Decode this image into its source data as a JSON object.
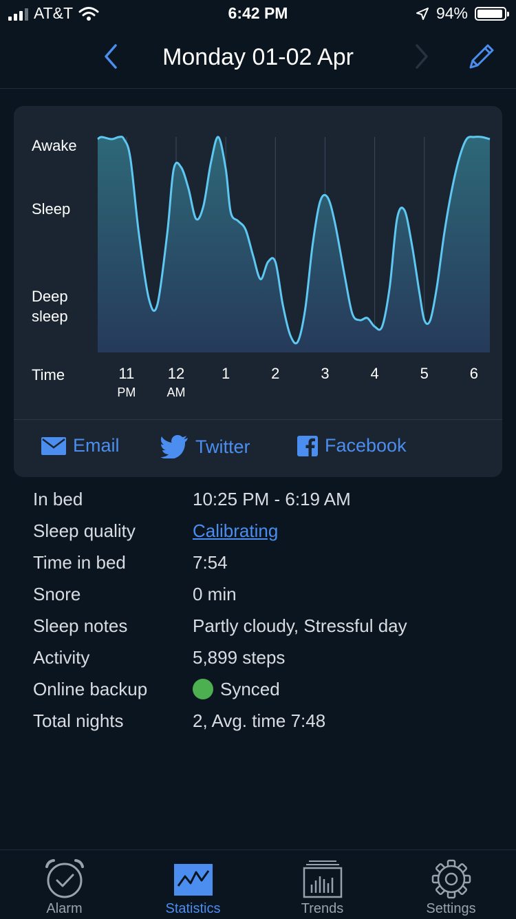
{
  "status_bar": {
    "carrier": "AT&T",
    "time": "6:42 PM",
    "battery": "94%",
    "battery_level": 0.94
  },
  "header": {
    "title": "Monday 01-02 Apr",
    "back_icon": "chevron-left-icon",
    "forward_icon": "chevron-right-icon",
    "edit_icon": "pencil-icon"
  },
  "chart_data": {
    "type": "area",
    "title": "",
    "y_levels": [
      "Awake",
      "Sleep",
      "Deep sleep"
    ],
    "y_range": [
      0,
      1
    ],
    "x_label": "Time",
    "x_ticks": [
      {
        "label": "11",
        "sub": "PM"
      },
      {
        "label": "12",
        "sub": "AM"
      },
      {
        "label": "1",
        "sub": ""
      },
      {
        "label": "2",
        "sub": ""
      },
      {
        "label": "3",
        "sub": ""
      },
      {
        "label": "4",
        "sub": ""
      },
      {
        "label": "5",
        "sub": ""
      },
      {
        "label": "6",
        "sub": ""
      }
    ],
    "x_tick_hours": [
      23,
      24,
      25,
      26,
      27,
      28,
      29,
      30
    ],
    "x_range_hours": [
      22.42,
      30.32
    ],
    "series": [
      {
        "x": [
          22.42,
          22.5,
          22.7,
          22.85,
          22.95,
          23.08,
          23.25,
          23.45,
          23.62,
          23.82,
          23.95,
          24.1,
          24.25,
          24.4,
          24.55,
          24.7,
          24.85,
          25.0,
          25.1,
          25.25,
          25.4,
          25.55,
          25.7,
          25.85,
          26.0,
          26.15,
          26.3,
          26.45,
          26.6,
          26.75,
          26.9,
          27.05,
          27.2,
          27.4,
          27.55,
          27.7,
          27.85,
          28.0,
          28.15,
          28.3,
          28.45,
          28.6,
          28.75,
          28.9,
          29.0,
          29.12,
          29.25,
          29.4,
          29.55,
          29.7,
          29.85,
          30.0,
          30.15,
          30.32
        ],
        "y": [
          0.99,
          1.0,
          0.99,
          1.0,
          0.99,
          0.9,
          0.55,
          0.25,
          0.22,
          0.55,
          0.85,
          0.86,
          0.76,
          0.62,
          0.68,
          0.88,
          1.0,
          0.85,
          0.65,
          0.61,
          0.57,
          0.45,
          0.34,
          0.42,
          0.42,
          0.22,
          0.08,
          0.05,
          0.2,
          0.5,
          0.7,
          0.72,
          0.6,
          0.35,
          0.18,
          0.15,
          0.16,
          0.12,
          0.12,
          0.3,
          0.62,
          0.66,
          0.5,
          0.28,
          0.15,
          0.15,
          0.3,
          0.55,
          0.75,
          0.9,
          0.99,
          1.0,
          1.0,
          0.99
        ]
      }
    ],
    "grid": true,
    "line_color": "#5ec8f2",
    "fill_color_top": "#2e6878",
    "fill_color_bottom": "#263a5a"
  },
  "share": {
    "email": "Email",
    "twitter": "Twitter",
    "facebook": "Facebook"
  },
  "details": [
    {
      "label": "In bed",
      "value": "10:25 PM - 6:19 AM"
    },
    {
      "label": "Sleep quality",
      "value": "Calibrating"
    },
    {
      "label": "Time in bed",
      "value": "7:54"
    },
    {
      "label": "Snore",
      "value": "0 min"
    },
    {
      "label": "Sleep notes",
      "value": "Partly cloudy, Stressful day"
    },
    {
      "label": "Activity",
      "value": "5,899 steps"
    },
    {
      "label": "Online backup",
      "value": "Synced"
    },
    {
      "label": "Total nights",
      "value": "2, Avg. time 7:48"
    }
  ],
  "tabs": [
    {
      "label": "Alarm",
      "icon": "alarm-clock-icon",
      "active": false
    },
    {
      "label": "Statistics",
      "icon": "statistics-icon",
      "active": true
    },
    {
      "label": "Trends",
      "icon": "trends-icon",
      "active": false
    },
    {
      "label": "Settings",
      "icon": "gear-icon",
      "active": false
    }
  ],
  "colors": {
    "accent": "#4b8ef0",
    "background": "#0b1520",
    "card": "#1b2532",
    "synced": "#4caf50"
  }
}
